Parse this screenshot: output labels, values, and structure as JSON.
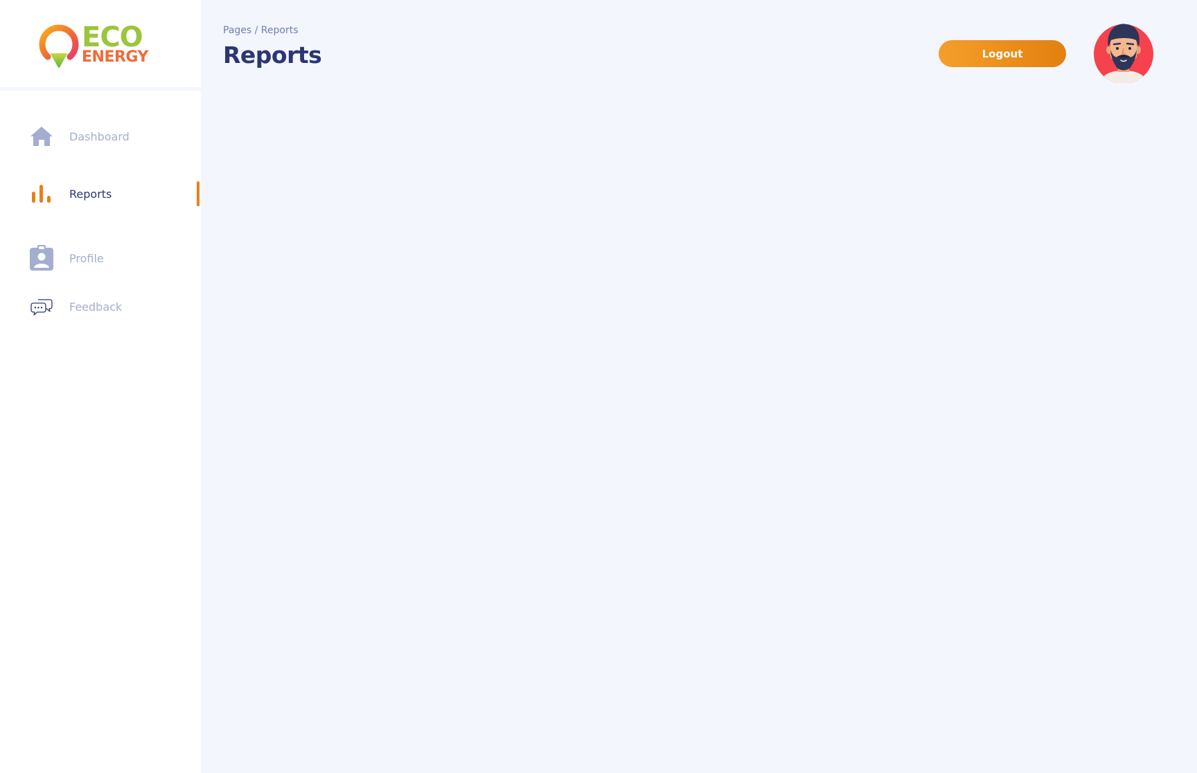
{
  "brand": {
    "line1": "ECO",
    "line2": "ENERGY"
  },
  "sidebar": {
    "items": [
      {
        "label": "Dashboard",
        "icon": "home-icon",
        "active": false
      },
      {
        "label": "Reports",
        "icon": "bar-chart-icon",
        "active": true
      },
      {
        "label": "Profile",
        "icon": "profile-badge-icon",
        "active": false
      },
      {
        "label": "Feedback",
        "icon": "chat-bubbles-icon",
        "active": false
      }
    ]
  },
  "header": {
    "breadcrumb": "Pages / Reports",
    "title": "Reports",
    "logout_label": "Logout"
  },
  "colors": {
    "accent": "#e8801a",
    "nav_inactive": "#a3aed0",
    "nav_active": "#2b3674",
    "main_bg": "#f3f6fd",
    "avatar_bg": "#f5424d"
  }
}
